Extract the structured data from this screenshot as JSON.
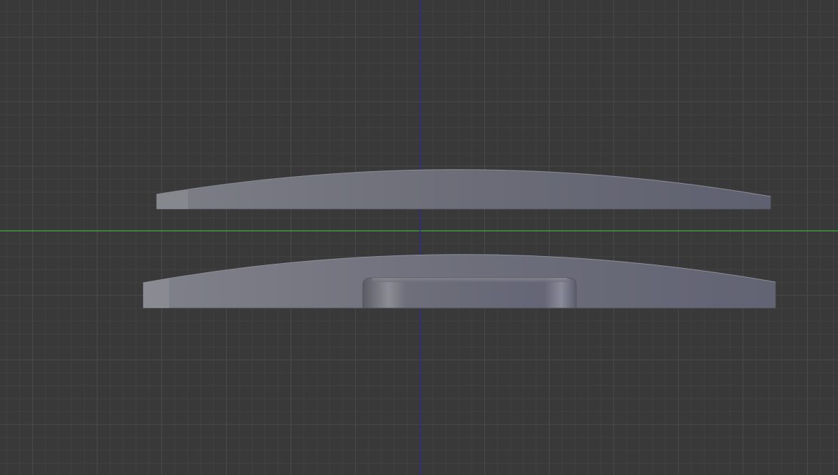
{
  "viewport": {
    "view": "3d-viewport-orthographic-front",
    "background_color": "#393939",
    "grid": {
      "visible": true,
      "minor_color": "#424242",
      "major_color": "#4a4a4a"
    },
    "axes": {
      "horizontal_axis_color": "#3f9a3f",
      "vertical_axis_color": "#2b2b96"
    },
    "objects": [
      {
        "name": "top-curved-plate",
        "color": "#6b6c78"
      },
      {
        "name": "bottom-curved-base",
        "color": "#6e6f7c"
      },
      {
        "name": "center-raised-block",
        "color": "#6a6b78"
      }
    ]
  }
}
